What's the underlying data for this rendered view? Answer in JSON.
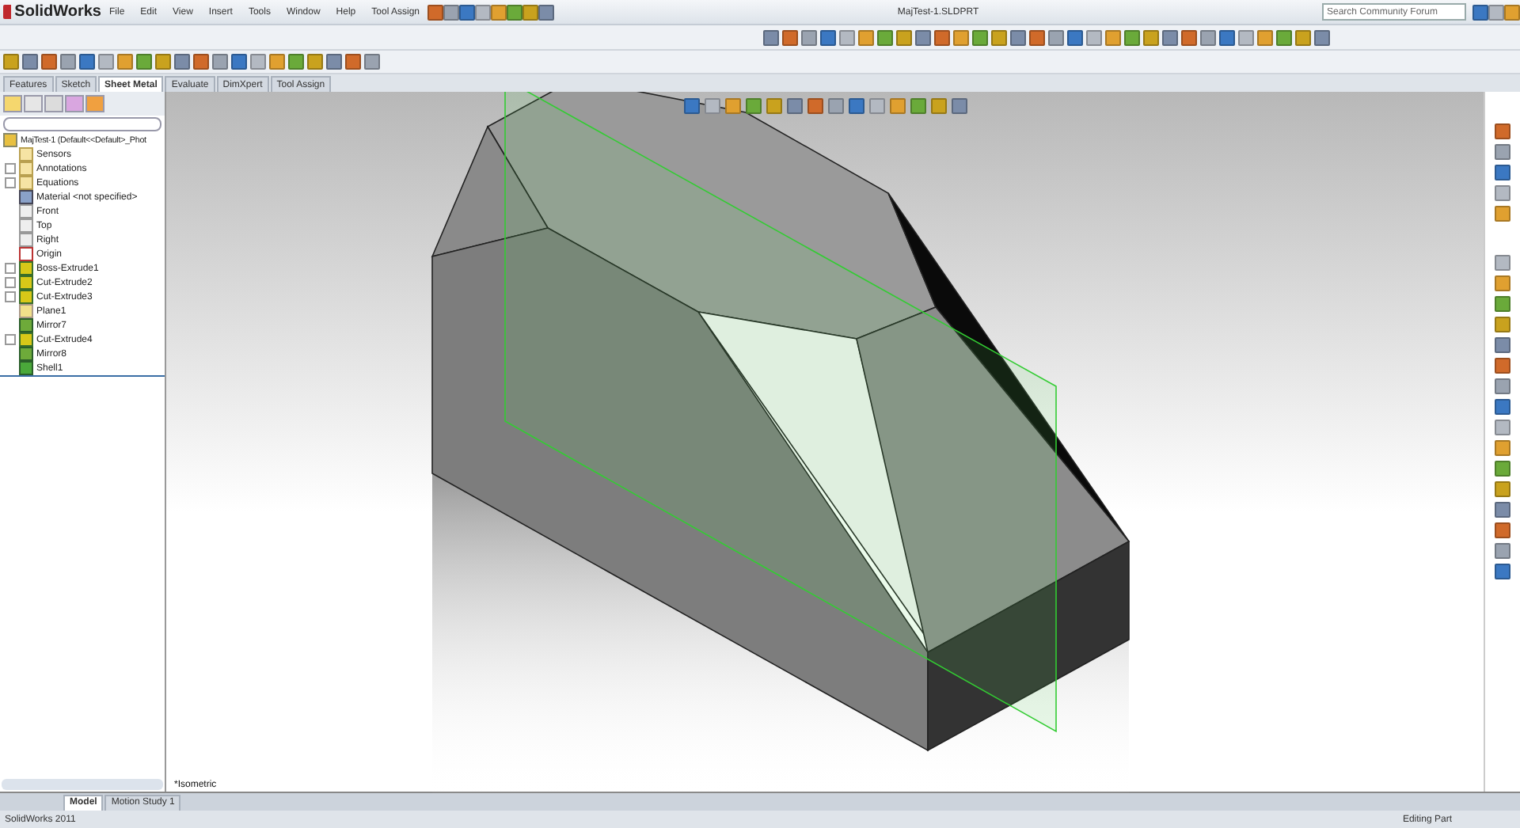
{
  "app": {
    "logo": "SolidWorks",
    "title": "MajTest-1.SLDPRT"
  },
  "menu": [
    "File",
    "Edit",
    "View",
    "Insert",
    "Tools",
    "Window",
    "Help",
    "Tool Assign"
  ],
  "search": {
    "placeholder": "Search Community Forum"
  },
  "command_tabs": [
    {
      "label": "Features",
      "selected": false
    },
    {
      "label": "Sketch",
      "selected": false
    },
    {
      "label": "Sheet Metal",
      "selected": true
    },
    {
      "label": "Evaluate",
      "selected": false
    },
    {
      "label": "DimXpert",
      "selected": false
    },
    {
      "label": "Tool Assign",
      "selected": false
    }
  ],
  "tree": {
    "root": "MajTest-1  (Default<<Default>_Phot",
    "items": [
      {
        "label": "Sensors",
        "kind": "folder",
        "expander": false
      },
      {
        "label": "Annotations",
        "kind": "annotation",
        "expander": true
      },
      {
        "label": "Equations",
        "kind": "equation",
        "expander": true
      },
      {
        "label": "Material <not specified>",
        "kind": "material",
        "expander": false
      },
      {
        "label": "Front",
        "kind": "plane",
        "expander": false
      },
      {
        "label": "Top",
        "kind": "plane",
        "expander": false
      },
      {
        "label": "Right",
        "kind": "plane",
        "expander": false
      },
      {
        "label": "Origin",
        "kind": "origin",
        "expander": false
      },
      {
        "label": "Boss-Extrude1",
        "kind": "feature",
        "expander": true
      },
      {
        "label": "Cut-Extrude2",
        "kind": "feature",
        "expander": true
      },
      {
        "label": "Cut-Extrude3",
        "kind": "feature",
        "expander": true
      },
      {
        "label": "Plane1",
        "kind": "refplane",
        "expander": false
      },
      {
        "label": "Mirror7",
        "kind": "mirror",
        "expander": false
      },
      {
        "label": "Cut-Extrude4",
        "kind": "feature",
        "expander": true
      },
      {
        "label": "Mirror8",
        "kind": "mirror",
        "expander": false
      },
      {
        "label": "Shell1",
        "kind": "shell",
        "expander": false
      }
    ]
  },
  "viewport": {
    "view_label": "*Isometric"
  },
  "bottom_tabs": [
    {
      "label": "Model",
      "selected": true
    },
    {
      "label": "Motion Study 1",
      "selected": false
    }
  ],
  "status_bar": {
    "app_version": "SolidWorks 2011",
    "mode": "Editing Part"
  }
}
